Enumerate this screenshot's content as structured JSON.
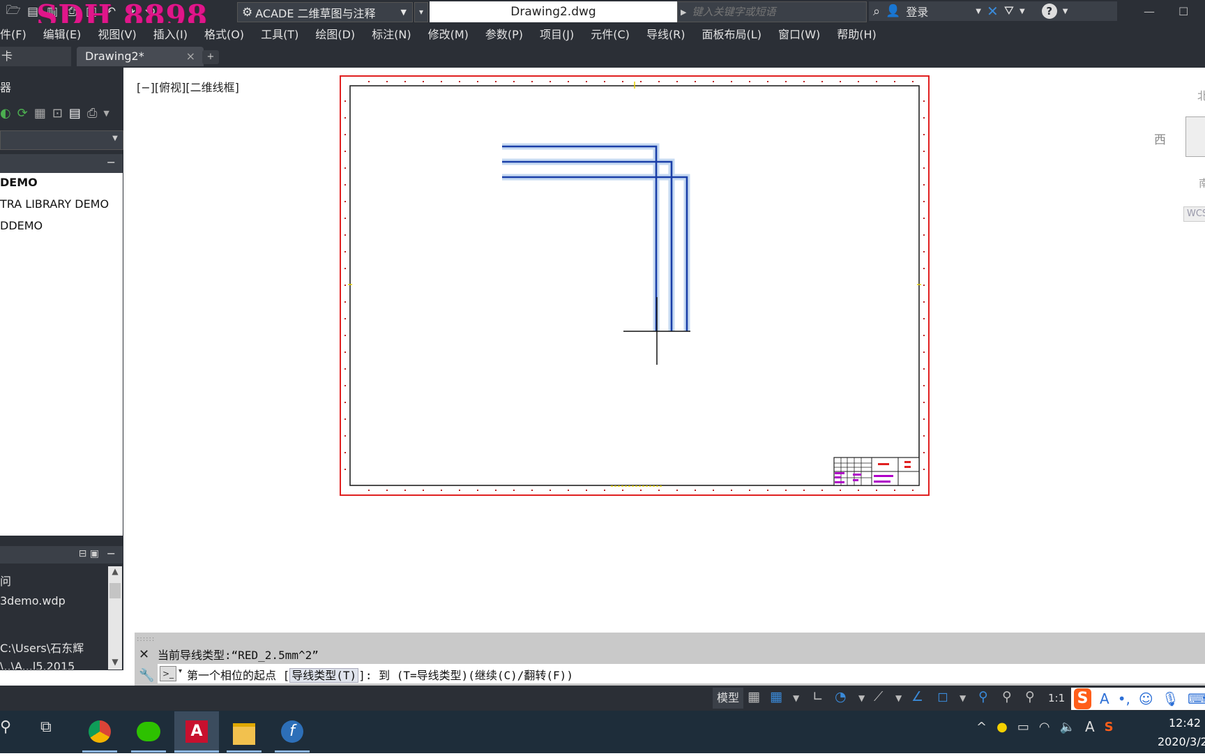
{
  "watermark": "SDH 8898",
  "quick_access": {
    "icons": [
      "open-icon",
      "save-icon",
      "print-icon",
      "undo-icon",
      "redo-icon",
      "share-icon"
    ],
    "workspace": "ACADE 二维草图与注释"
  },
  "title": "Drawing2.dwg",
  "search": {
    "placeholder": "键入关键字或短语"
  },
  "login": "登录",
  "menu": [
    "件(F)",
    "编辑(E)",
    "视图(V)",
    "插入(I)",
    "格式(O)",
    "工具(T)",
    "绘图(D)",
    "标注(N)",
    "修改(M)",
    "参数(P)",
    "项目(J)",
    "元件(C)",
    "导线(R)",
    "面板布局(L)",
    "窗口(W)",
    "帮助(H)"
  ],
  "tabs": {
    "partial": "卡",
    "active": "Drawing2*",
    "close": "×",
    "add": "+"
  },
  "left_panel": {
    "title": "器",
    "projects": [
      {
        "label": "DEMO",
        "bold": true
      },
      {
        "label": "TRA LIBRARY DEMO",
        "bold": false
      },
      {
        "label": "DDEMO",
        "bold": false
      }
    ],
    "details": [
      "问",
      "3demo.wdp",
      "C:\\Users\\石东辉",
      "\\..\\A...l5.2015"
    ]
  },
  "viewport": {
    "label": "[−][俯视][二维线框]",
    "compass": {
      "north": "北",
      "west": "西",
      "south": "南"
    },
    "wcs": "WCS"
  },
  "command": {
    "history": "当前导线类型:“RED_2.5mm^2”",
    "prompt_prefix": "第一个相位的起点 [",
    "prompt_option": "导线类型(T)",
    "prompt_suffix": "]:  到  (T=导线类型)(继续(C)/翻转(F))"
  },
  "status_bar": {
    "model": "模型",
    "scale": "1:1"
  },
  "clock": {
    "time": "12:42",
    "date": "2020/3/2"
  },
  "colors": {
    "ui_dark": "#2b2f36",
    "frame_red": "#e02020",
    "wire_blue": "#1a3fa8",
    "wire_glow": "#c6daf2",
    "titleblock_purple": "#b000c8",
    "titleblock_red": "#e02020",
    "accent_blue": "#3a8ad9"
  }
}
